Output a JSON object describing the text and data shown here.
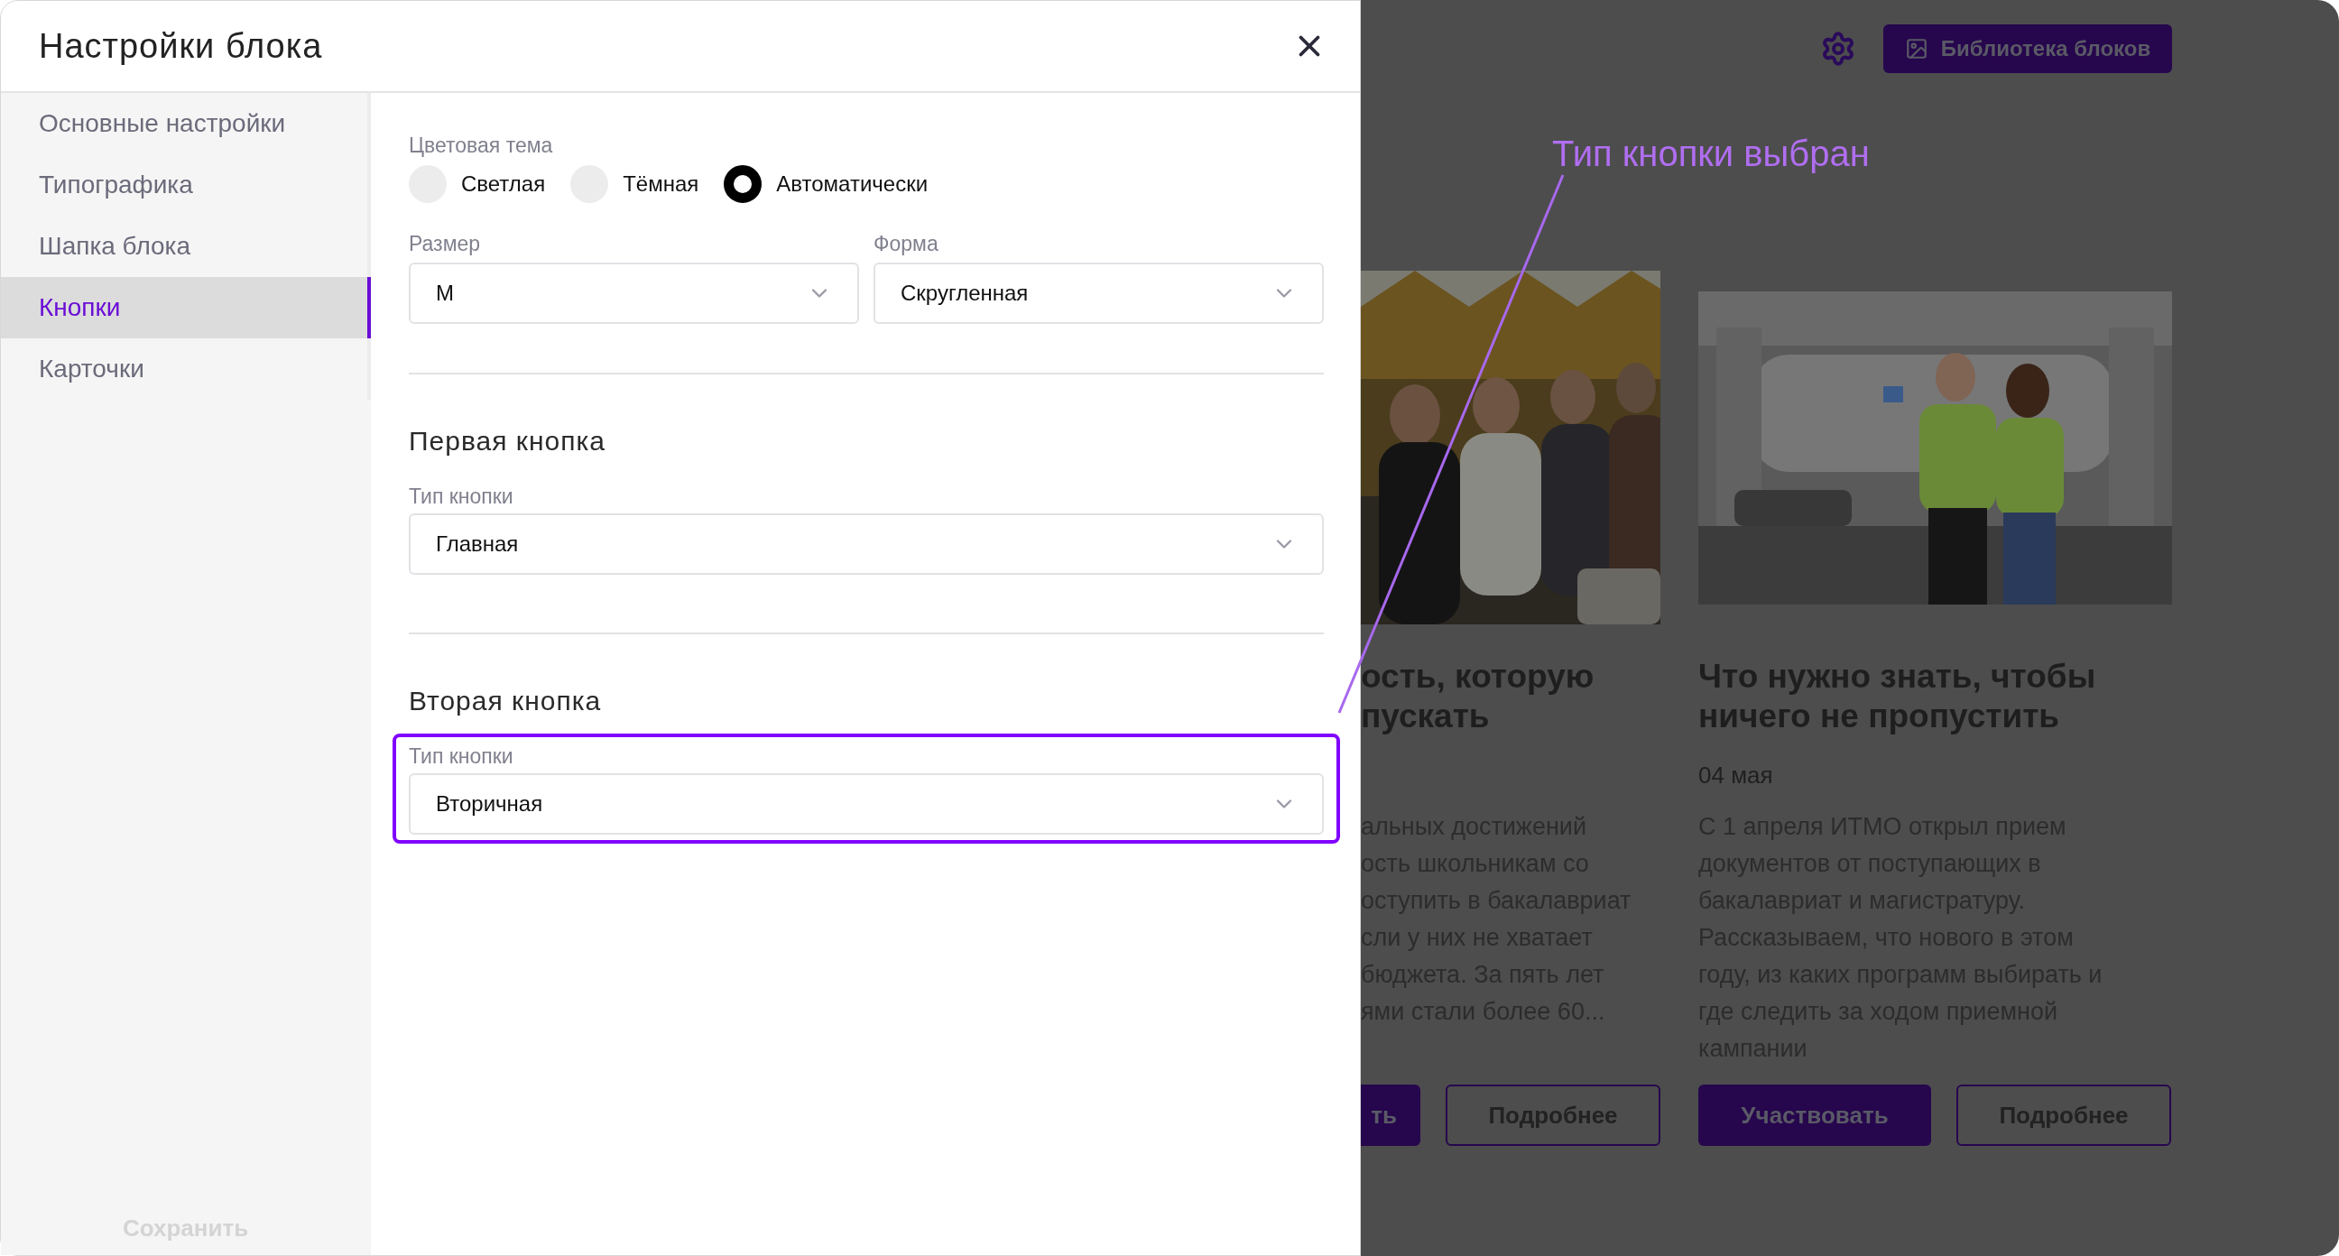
{
  "dialog": {
    "title": "Настройки блока"
  },
  "sidebar": {
    "items": [
      {
        "label": "Основные настройки",
        "selected": false
      },
      {
        "label": "Типографика",
        "selected": false
      },
      {
        "label": "Шапка блока",
        "selected": false
      },
      {
        "label": "Кнопки",
        "selected": true
      },
      {
        "label": "Карточки",
        "selected": false
      }
    ],
    "save": "Сохранить"
  },
  "color_theme": {
    "label": "Цветовая тема",
    "options": [
      {
        "label": "Светлая",
        "selected": false
      },
      {
        "label": "Тёмная",
        "selected": false
      },
      {
        "label": "Автоматически",
        "selected": true
      }
    ]
  },
  "size": {
    "label": "Размер",
    "value": "М"
  },
  "shape": {
    "label": "Форма",
    "value": "Скругленная"
  },
  "sections": [
    {
      "title": "Первая кнопка",
      "field_label": "Тип кнопки",
      "value": "Главная",
      "highlighted": false
    },
    {
      "title": "Вторая кнопка",
      "field_label": "Тип кнопки",
      "value": "Вторичная",
      "highlighted": true
    }
  ],
  "annotation": {
    "text": "Тип кнопки выбран"
  },
  "background_page": {
    "library_button": "Библиотека блоков",
    "cards": [
      {
        "title_lines": [
          "ость, которую",
          "пускать"
        ],
        "body_lines": [
          "альных достижений",
          "ость школьникам со",
          "оступить в бакалавриат",
          "сли у них не хватает",
          "бюджета. За пять лет",
          "ями стали более 60..."
        ],
        "buttons": [
          "ть",
          "Подробнее"
        ]
      },
      {
        "title_lines": [
          "Что нужно знать, чтобы",
          "ничего не пропустить"
        ],
        "date": "04 мая",
        "body_lines": [
          "С 1 апреля ИТМО открыл прием",
          "документов от поступающих в",
          "бакалавриат и магистратуру.",
          "Рассказываем, что нового в этом",
          "году, из каких программ выбирать и",
          "где следить за ходом приемной",
          "кампании"
        ],
        "buttons": [
          "Участвовать",
          "Подробнее"
        ]
      }
    ]
  }
}
